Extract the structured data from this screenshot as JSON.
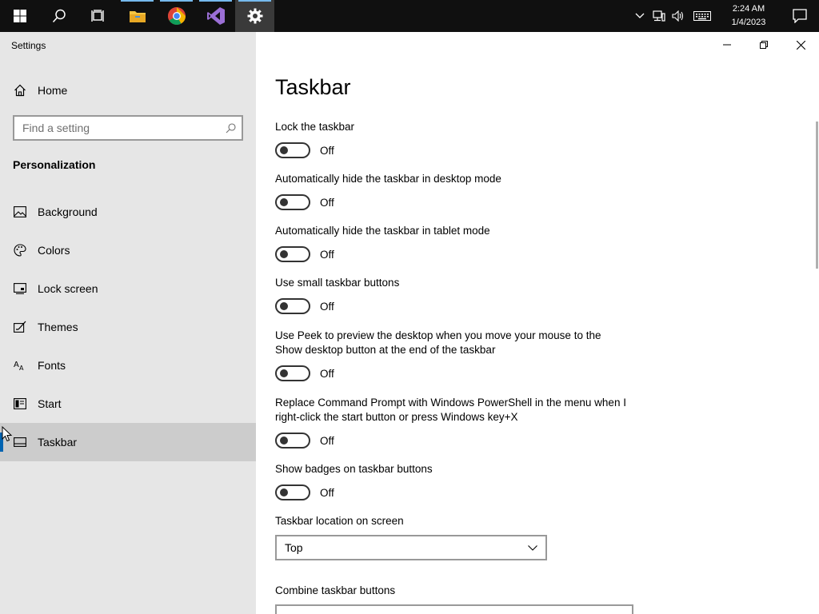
{
  "taskbar": {
    "apps": [
      {
        "name": "start",
        "icon": "windows-logo-icon"
      },
      {
        "name": "search",
        "icon": "search-icon"
      },
      {
        "name": "task-view",
        "icon": "task-view-icon"
      },
      {
        "name": "file-explorer",
        "icon": "folder-icon"
      },
      {
        "name": "chrome",
        "icon": "chrome-icon"
      },
      {
        "name": "visual-studio",
        "icon": "visual-studio-icon"
      },
      {
        "name": "settings",
        "icon": "gear-icon"
      }
    ],
    "clock": {
      "time": "2:24 AM",
      "date": "1/4/2023"
    }
  },
  "window": {
    "title": "Settings"
  },
  "sidebar": {
    "home_label": "Home",
    "search_placeholder": "Find a setting",
    "section_heading": "Personalization",
    "items": [
      {
        "label": "Background",
        "icon": "image-icon"
      },
      {
        "label": "Colors",
        "icon": "palette-icon"
      },
      {
        "label": "Lock screen",
        "icon": "lock-screen-icon"
      },
      {
        "label": "Themes",
        "icon": "themes-icon"
      },
      {
        "label": "Fonts",
        "icon": "fonts-icon"
      },
      {
        "label": "Start",
        "icon": "start-icon"
      },
      {
        "label": "Taskbar",
        "icon": "taskbar-icon",
        "selected": true
      }
    ]
  },
  "main": {
    "title": "Taskbar",
    "toggles": [
      {
        "label": "Lock the taskbar",
        "state": "Off"
      },
      {
        "label": "Automatically hide the taskbar in desktop mode",
        "state": "Off"
      },
      {
        "label": "Automatically hide the taskbar in tablet mode",
        "state": "Off"
      },
      {
        "label": "Use small taskbar buttons",
        "state": "Off"
      },
      {
        "label": "Use Peek to preview the desktop when you move your mouse to the Show desktop button at the end of the taskbar",
        "state": "Off"
      },
      {
        "label": "Replace Command Prompt with Windows PowerShell in the menu when I right-click the start button or press Windows key+X",
        "state": "Off"
      },
      {
        "label": "Show badges on taskbar buttons",
        "state": "Off"
      }
    ],
    "location": {
      "label": "Taskbar location on screen",
      "value": "Top"
    },
    "combine": {
      "label": "Combine taskbar buttons"
    }
  },
  "colors": {
    "accent": "#0063b1",
    "taskbar_bg": "#101010",
    "sidebar_bg": "#e6e6e6",
    "selected_bg": "#cccccc"
  }
}
